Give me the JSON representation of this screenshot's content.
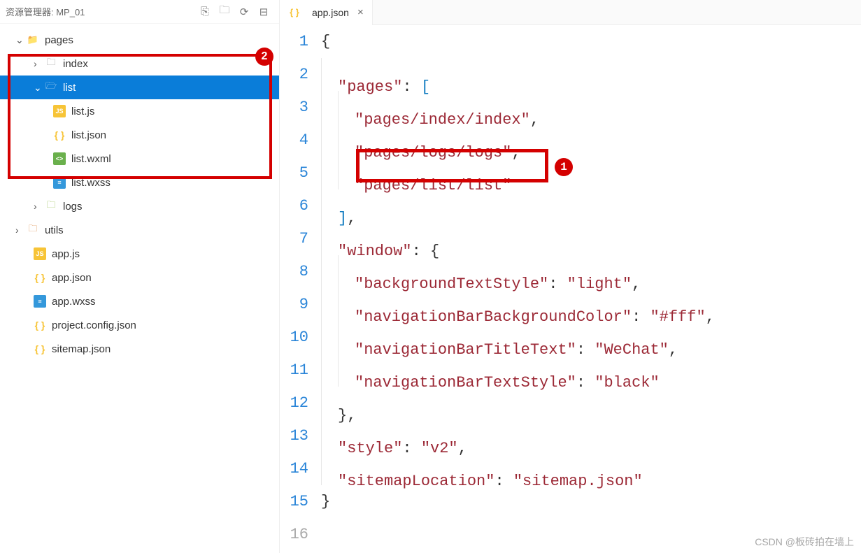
{
  "explorer": {
    "title": "资源管理器: MP_01",
    "root": "pages",
    "items": [
      {
        "name": "index"
      },
      {
        "name": "list",
        "children": [
          "list.js",
          "list.json",
          "list.wxml",
          "list.wxss"
        ]
      },
      {
        "name": "logs"
      }
    ],
    "siblings": [
      "utils"
    ],
    "root_files": [
      "app.js",
      "app.json",
      "app.wxss",
      "project.config.json",
      "sitemap.json"
    ]
  },
  "tabs": {
    "active": "app.json"
  },
  "badges": {
    "one": "1",
    "two": "2"
  },
  "code": {
    "line_start": 1,
    "line_end": 16,
    "tokens": {
      "l2_key": "\"pages\"",
      "l3": "\"pages/index/index\"",
      "l4": "\"pages/logs/logs\"",
      "l5": "\"pages/list/list\"",
      "l7_key": "\"window\"",
      "l8k": "\"backgroundTextStyle\"",
      "l8v": "\"light\"",
      "l9k": "\"navigationBarBackgroundColor\"",
      "l9v": "\"#fff\"",
      "l10k": "\"navigationBarTitleText\"",
      "l10v": "\"WeChat\"",
      "l11k": "\"navigationBarTextStyle\"",
      "l11v": "\"black\"",
      "l13k": "\"style\"",
      "l13v": "\"v2\"",
      "l14k": "\"sitemapLocation\"",
      "l14v": "\"sitemap.json\""
    }
  },
  "watermark": "CSDN @板砖拍在墙上"
}
